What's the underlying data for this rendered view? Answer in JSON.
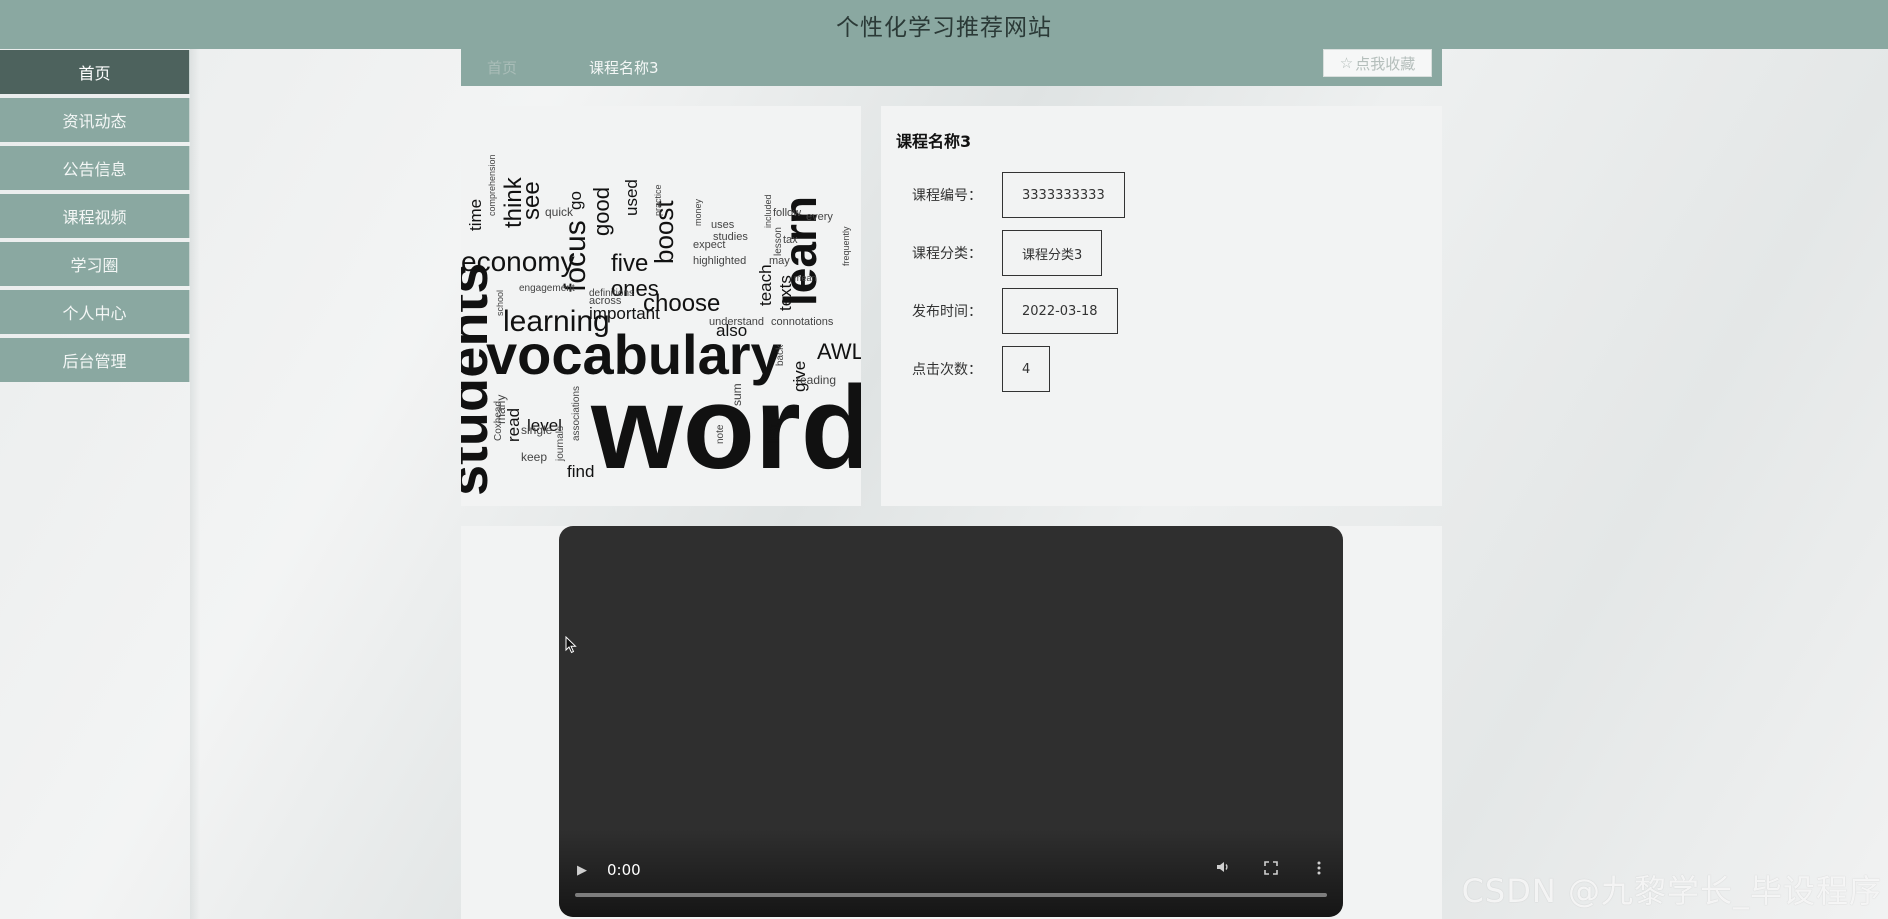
{
  "header": {
    "site_title": "个性化学习推荐网站"
  },
  "sidebar": {
    "items": [
      {
        "label": "首页",
        "active": true
      },
      {
        "label": "资讯动态"
      },
      {
        "label": "公告信息"
      },
      {
        "label": "课程视频"
      },
      {
        "label": "学习圈"
      },
      {
        "label": "个人中心"
      },
      {
        "label": "后台管理"
      }
    ]
  },
  "breadcrumb": {
    "home": "首页",
    "current": "课程名称3"
  },
  "favorite_button": {
    "star": "☆",
    "label": "点我收藏"
  },
  "course": {
    "name": "课程名称3",
    "fields": [
      {
        "label": "课程编号：",
        "value": "3333333333"
      },
      {
        "label": "课程分类：",
        "value": "课程分类3"
      },
      {
        "label": "发布时间：",
        "value": "2022-03-18"
      },
      {
        "label": "点击次数：",
        "value": "4"
      }
    ]
  },
  "word_cloud_words": [
    "word",
    "vocabulary",
    "students",
    "learning",
    "learn",
    "economy",
    "focus",
    "see",
    "think",
    "choose",
    "boost",
    "five",
    "ones",
    "important",
    "good",
    "AWL",
    "teach",
    "texts",
    "also",
    "level",
    "read",
    "find",
    "list",
    "give",
    "used",
    "time",
    "quick",
    "go",
    "many",
    "single",
    "keep",
    "reading",
    "sum",
    "note",
    "highlighted",
    "expect",
    "uses",
    "studies",
    "money",
    "practice",
    "follow",
    "every",
    "tax",
    "may",
    "frequently",
    "definitions",
    "across",
    "understand",
    "connotations",
    "back",
    "engagement",
    "school",
    "Coxhead",
    "journals",
    "associations",
    "comprehension",
    "lesson",
    "included",
    "mean"
  ],
  "video": {
    "time": "0:00",
    "progress": 0
  },
  "watermark": "CSDN @九黎学长_毕设程序"
}
